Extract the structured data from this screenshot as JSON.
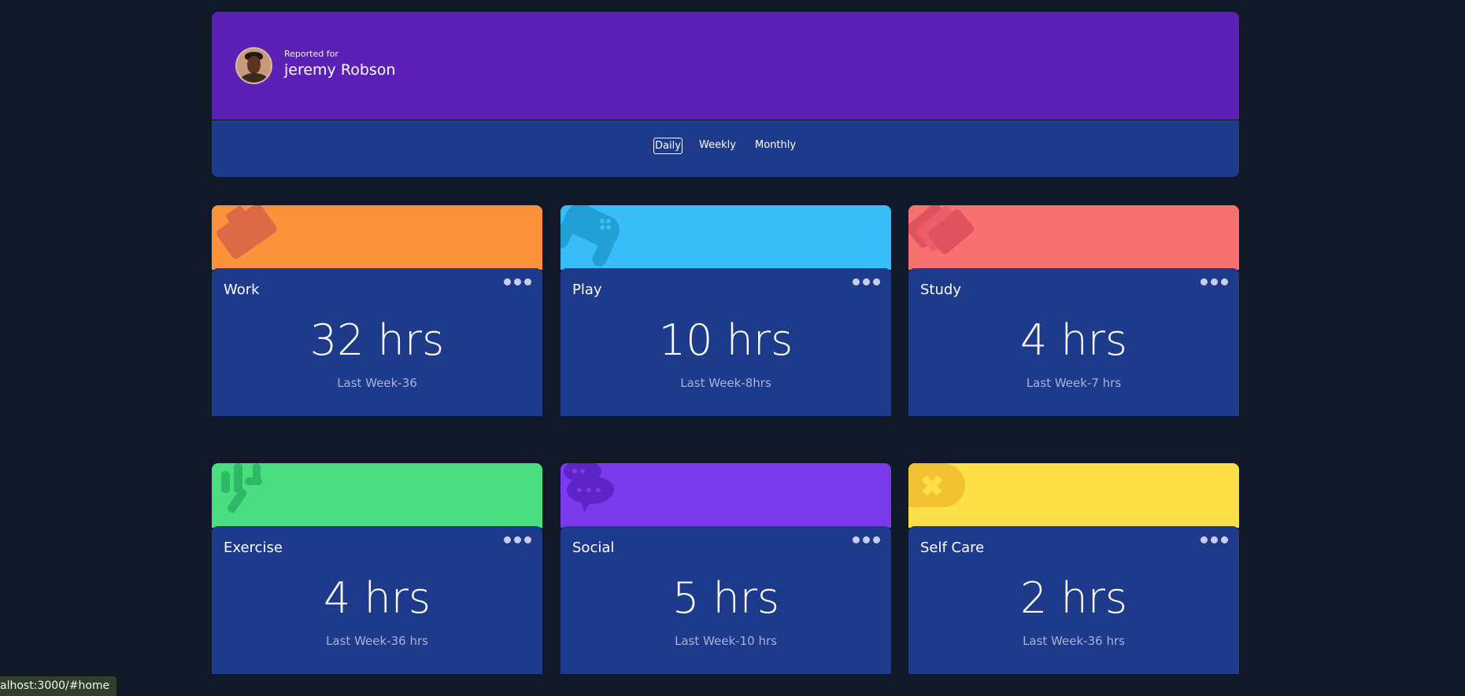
{
  "profile": {
    "reported_for": "Reported for",
    "name": "jeremy Robson"
  },
  "tabs": [
    {
      "label": "Daily",
      "active": true
    },
    {
      "label": "Weekly",
      "active": false
    },
    {
      "label": "Monthly",
      "active": false
    }
  ],
  "cards": [
    {
      "title": "Work",
      "hours": "32 hrs",
      "last_week": "Last Week-36",
      "color": "#fb923c",
      "icon": "briefcase-icon"
    },
    {
      "title": "Play",
      "hours": "10 hrs",
      "last_week": "Last Week-8hrs",
      "color": "#38bdf8",
      "icon": "gamepad-icon"
    },
    {
      "title": "Study",
      "hours": "4 hrs",
      "last_week": "Last Week-7 hrs",
      "color": "#f87171",
      "icon": "books-icon"
    },
    {
      "title": "Exercise",
      "hours": "4 hrs",
      "last_week": "Last Week-36 hrs",
      "color": "#4ade80",
      "icon": "running-icon"
    },
    {
      "title": "Social",
      "hours": "5 hrs",
      "last_week": "Last Week-10 hrs",
      "color": "#7c3aed",
      "icon": "chat-icon"
    },
    {
      "title": "Self Care",
      "hours": "2 hrs",
      "last_week": "Last Week-36 hrs",
      "color": "#fde047",
      "icon": "bandage-icon"
    }
  ],
  "status_bar": {
    "url": "alhost:3000/#home"
  }
}
